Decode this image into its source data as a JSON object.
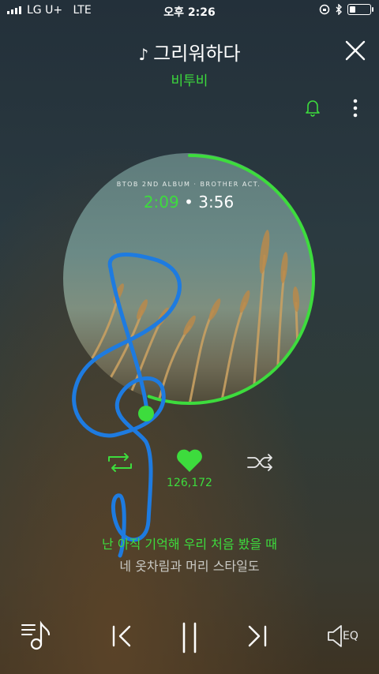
{
  "status": {
    "carrier": "LG U+",
    "network": "LTE",
    "time": "오후 2:26",
    "battery_level": 0.3
  },
  "song": {
    "title": "그리워하다",
    "artist": "비투비",
    "album_text": "BTOB 2ND ALBUM · BROTHER ACT."
  },
  "playback": {
    "current_time": "2:09",
    "separator": "•",
    "total_time": "3:56",
    "progress": 0.553
  },
  "likes": {
    "count": "126,172"
  },
  "lyrics": {
    "current": "난 아직 기억해 우리 처음 봤을 때",
    "next": "네 옷차림과 머리 스타일도"
  },
  "controls": {
    "eq_label": "EQ"
  },
  "colors": {
    "accent": "#3ddc3d",
    "annotation": "#1e7be0"
  },
  "icons": [
    "music-note-icon",
    "close-icon",
    "bell-icon",
    "more-icon",
    "repeat-icon",
    "heart-icon",
    "shuffle-icon",
    "playlist-icon",
    "previous-icon",
    "pause-icon",
    "next-icon",
    "eq-icon"
  ]
}
